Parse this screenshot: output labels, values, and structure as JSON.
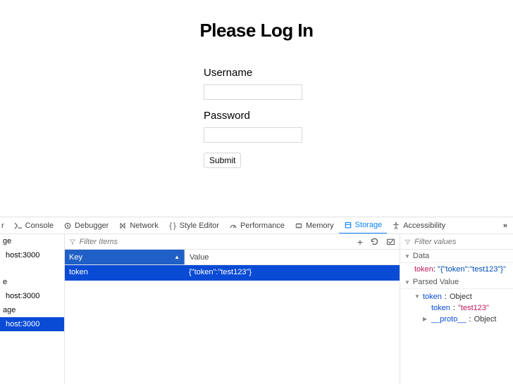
{
  "page": {
    "heading": "Please Log In",
    "username_label": "Username",
    "password_label": "Password",
    "submit_label": "Submit"
  },
  "devtools": {
    "tabs": {
      "partial_left": "r",
      "console": "Console",
      "debugger": "Debugger",
      "network": "Network",
      "style_editor": "Style Editor",
      "performance": "Performance",
      "memory": "Memory",
      "storage": "Storage",
      "accessibility": "Accessibility",
      "more": "»"
    },
    "active_tab": "Storage",
    "sidebar": {
      "groups": [
        {
          "label": "ge",
          "hosts": [
            "host:3000"
          ]
        },
        {
          "label": "e",
          "hosts": [
            "host:3000"
          ]
        },
        {
          "label": "age",
          "hosts": [
            "host:3000"
          ]
        }
      ],
      "selected_host": "host:3000"
    },
    "toolbar": {
      "filter_placeholder": "Filter Items",
      "add": "+",
      "refresh": "↻",
      "delete": "⊟"
    },
    "grid": {
      "columns": {
        "key": "Key",
        "value": "Value"
      },
      "sort_indicator": "▲",
      "rows": [
        {
          "key": "token",
          "value": "{\"token\":\"test123\"}"
        }
      ]
    },
    "details": {
      "filter_placeholder": "Filter values",
      "data_section": "Data",
      "data_kv": {
        "key": "token",
        "value": "\"{\"token\":\"test123\"}\""
      },
      "parsed_section": "Parsed Value",
      "tree": {
        "root_name": "token",
        "root_type": "Object",
        "child_name": "token",
        "child_value": "\"test123\"",
        "proto_name": "__proto__",
        "proto_type": "Object"
      }
    }
  }
}
